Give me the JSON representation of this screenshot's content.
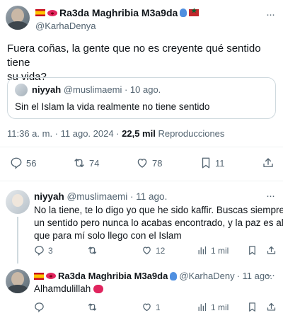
{
  "main_tweet": {
    "display_name": "Ra3da Maghribia M3a9da",
    "handle": "@KarhaDenya",
    "text_line1": "Fuera coñas, la gente que no es creyente qué sentido tiene",
    "text_line2": "su vida?",
    "quote": {
      "display_name": "niyyah",
      "handle": "@muslimaemi",
      "date": "· 10 ago.",
      "text": "Sin el Islam la vida realmente no tiene sentido"
    },
    "timestamp": "11:36 a. m. · 11 ago. 2024 ·",
    "views_count": "22,5 mil",
    "views_label": "Reproducciones",
    "replies": "56",
    "retweets": "74",
    "likes": "78",
    "bookmarks": "11"
  },
  "reply1": {
    "display_name": "niyyah",
    "handle": "@muslimaemi",
    "date": "· 11 ago.",
    "lines": [
      "No la tiene, te lo digo yo que he sido kaffir. Buscas siempre",
      "un sentido pero nunca lo acabas encontrado, y la paz es algo",
      "que para mí solo llego con el Islam"
    ],
    "replies": "3",
    "retweets": "",
    "likes": "12",
    "views": "1 mil"
  },
  "reply2": {
    "display_name": "Ra3da Maghribia M3a9da",
    "handle": "@KarhaDeny",
    "date": "· 11 ago.",
    "text": "Alhamdulillah",
    "replies": "",
    "retweets": "",
    "likes": "1",
    "views": "1 mil"
  },
  "colors": {
    "text": "#0f1419",
    "muted": "#536471",
    "divider": "#eff3f4",
    "verified_like": "#e0245e"
  },
  "icons": [
    "more-icon",
    "reply-icon",
    "retweet-icon",
    "like-icon",
    "bookmark-icon",
    "share-icon",
    "views-icon"
  ]
}
